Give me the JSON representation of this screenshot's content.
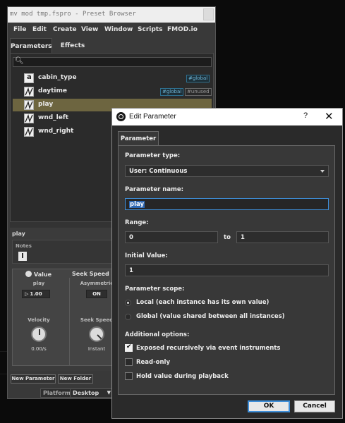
{
  "preset_browser": {
    "title": "mv mod tmp.fspro - Preset Browser",
    "menu": [
      "File",
      "Edit",
      "Create",
      "View",
      "Window",
      "Scripts",
      "FMOD.io"
    ],
    "tabs": [
      "Parameters",
      "Effects"
    ],
    "parameters": [
      {
        "name": "cabin_type",
        "icon": "label-parameter-icon",
        "tags": [
          "#global"
        ],
        "selected": false
      },
      {
        "name": "daytime",
        "icon": "continuous-parameter-icon",
        "tags": [
          "#global",
          "#unused"
        ],
        "selected": false
      },
      {
        "name": "play",
        "icon": "continuous-parameter-icon",
        "tags": [],
        "selected": true
      },
      {
        "name": "wnd_left",
        "icon": "continuous-parameter-icon",
        "tags": [],
        "selected": false
      },
      {
        "name": "wnd_right",
        "icon": "continuous-parameter-icon",
        "tags": [],
        "selected": false
      }
    ],
    "selected_name": "play",
    "notes_label": "Notes",
    "value_header": "Value",
    "seek_header": "Seek Speed",
    "play_label": "play",
    "play_value": "1.00",
    "asymmetric_label": "Asymmetric",
    "asymmetric_value": "ON",
    "velocity_label": "Velocity",
    "velocity_value": "0.00/s",
    "seek_speed_label": "Seek Speed",
    "seek_speed_value": "Instant",
    "new_parameter": "New Parameter",
    "new_folder": "New Folder",
    "platform_label": "Platform",
    "platform_value": "Desktop"
  },
  "dialog": {
    "title": "Edit Parameter",
    "help": "?",
    "close": "✕",
    "tab": "Parameter",
    "type_label": "Parameter type:",
    "type_value": "User: Continuous",
    "name_label": "Parameter name:",
    "name_value": "play",
    "range_label": "Range:",
    "range_min": "0",
    "range_to": "to",
    "range_max": "1",
    "initial_label": "Initial Value:",
    "initial_value": "1",
    "scope_label": "Parameter scope:",
    "scope_local": "Local (each instance has its own value)",
    "scope_global": "Global (value shared between all instances)",
    "scope_selected": "local",
    "additional_label": "Additional options:",
    "options": [
      {
        "label": "Exposed recursively via event instruments",
        "checked": true
      },
      {
        "label": "Read-only",
        "checked": false
      },
      {
        "label": "Hold value during playback",
        "checked": false
      }
    ],
    "ok": "OK",
    "cancel": "Cancel",
    "accent_color": "#3e8ed8"
  }
}
